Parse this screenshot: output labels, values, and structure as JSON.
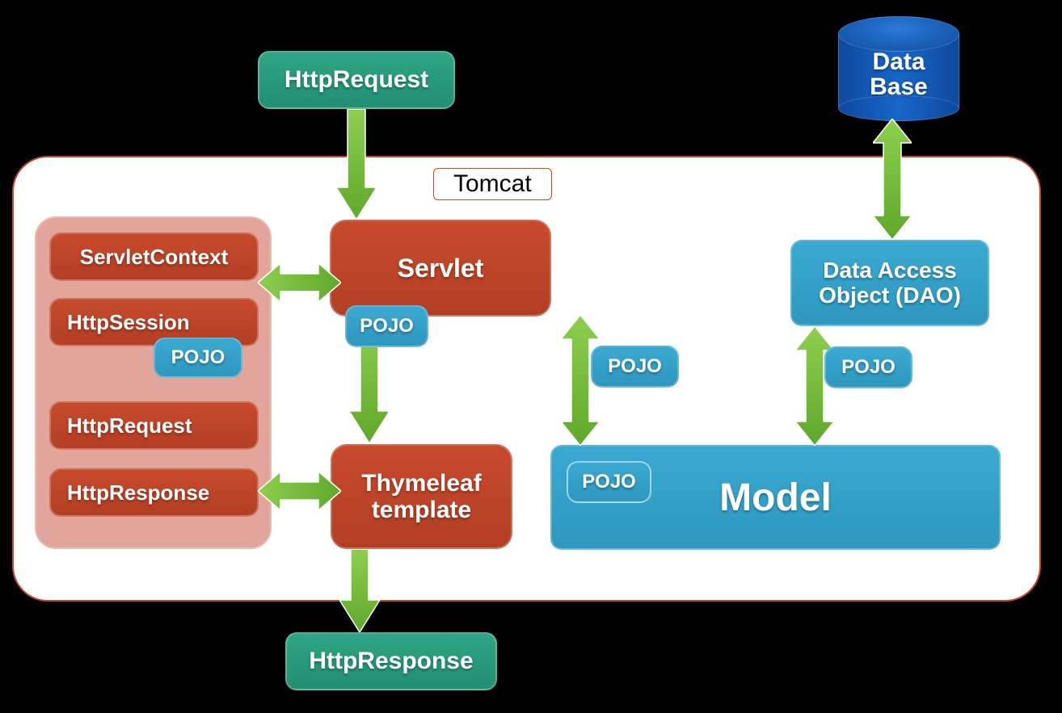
{
  "nodes": {
    "http_request_top": "HttpRequest",
    "http_response_bottom": "HttpResponse",
    "database": "Data\nBase",
    "tomcat_label": "Tomcat",
    "servlet": "Servlet",
    "thymeleaf": "Thymeleaf template",
    "dao": "Data Access Object (DAO)",
    "model": "Model",
    "servlet_context": "ServletContext",
    "http_session": "HttpSession",
    "http_request_ctx": "HttpRequest",
    "http_response_ctx": "HttpResponse"
  },
  "badges": {
    "pojo": "POJO"
  },
  "colors": {
    "green": "#2fa683",
    "red": "#c24a2b",
    "blue": "#3aa9d1",
    "arrow": "#7bc043",
    "darkblue": "#0d4a9e",
    "pink": "#d88c80"
  }
}
